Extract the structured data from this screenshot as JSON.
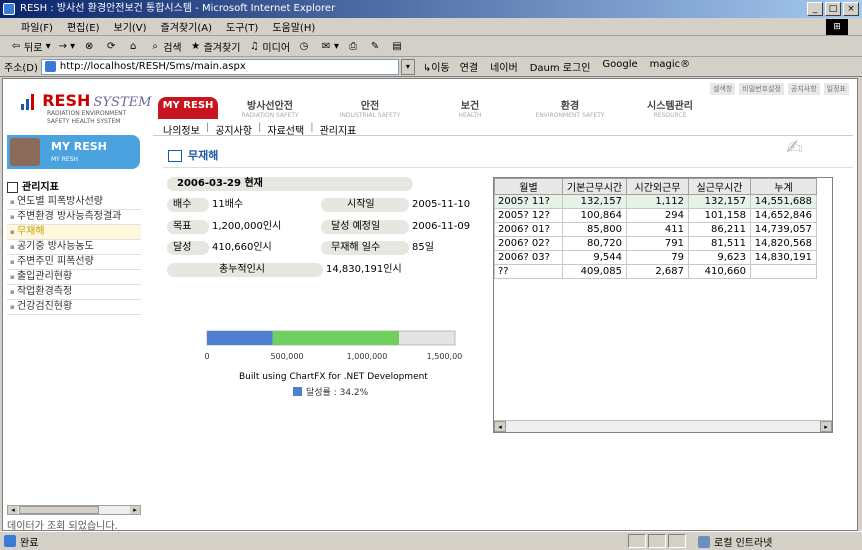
{
  "window": {
    "title": "RESH : 방사선 환경안전보건 통합시스템 - Microsoft Internet Explorer",
    "min": "_",
    "max": "□",
    "close": "×"
  },
  "menu": [
    "파일(F)",
    "편집(E)",
    "보기(V)",
    "즐겨찾기(A)",
    "도구(T)",
    "도움말(H)"
  ],
  "toolbar": {
    "back": "뒤로",
    "forward": "→",
    "search": "검색",
    "favorites": "즐겨찾기",
    "media": "미디어"
  },
  "address": {
    "label": "주소(D)",
    "url": "http://localhost/RESH/Sms/main.aspx",
    "go": "이동",
    "links_label": "연결",
    "links": [
      "네이버",
      "Daum 로그인",
      "Google",
      "magic®"
    ]
  },
  "topright": [
    "셀색창",
    "비밀번호설정",
    "공지사항",
    "일정표"
  ],
  "logo": {
    "resh": "RESH",
    "system": "SYSTEM",
    "sub1": "RADIATION ENVIRONMENT",
    "sub2": "SAFETY HEALTH SYSTEM"
  },
  "mainnav": [
    {
      "t": "MY RESH",
      "s": ""
    },
    {
      "t": "방사선안전",
      "s": "RADIATION SAFETY"
    },
    {
      "t": "안전",
      "s": "INDUSTRIAL SAFETY"
    },
    {
      "t": "보건",
      "s": "HEALTH"
    },
    {
      "t": "환경",
      "s": "ENVIRONMENT SAFETY"
    },
    {
      "t": "시스템관리",
      "s": "RESOURCE"
    }
  ],
  "subnav": [
    "나의정보",
    "공지사항",
    "자료선택",
    "관리지표"
  ],
  "myresh": {
    "t": "MY RESH",
    "s": "MY RESH"
  },
  "sidebar": {
    "title": "관리지표",
    "items": [
      "연도별 피폭방사선량",
      "주변환경 방사능측정결과",
      "무재해",
      "공기중 방사능농도",
      "주변주민 피폭선량",
      "출입관리현황",
      "작업환경측정",
      "건강검진현황"
    ],
    "active_index": 2
  },
  "status_message": "데이터가 조회 되었습니다.",
  "section_title": "무재해",
  "summary": {
    "date_label": "2006-03-29 현재",
    "multiple_label": "배수",
    "multiple_value": "11배수",
    "start_label": "시작일",
    "start_value": "2005-11-10",
    "target_label": "목표",
    "target_value": "1,200,000인시",
    "expected_label": "달성 예정일",
    "expected_value": "2006-11-09",
    "achieved_label": "달성",
    "achieved_value": "410,660인시",
    "days_label": "무재해 일수",
    "days_value": "85일",
    "total_label": "총누적인시",
    "total_value": "14,830,191인시"
  },
  "chart_data": {
    "type": "bar",
    "orientation": "horizontal",
    "ticks": [
      "0",
      "500,000",
      "1,000,000",
      "1,500,000"
    ],
    "xlim": [
      0,
      1500000
    ],
    "segments": [
      {
        "value": 410660,
        "color": "#4f7fcf"
      },
      {
        "value": 1200000,
        "color": "#6fcf5f"
      }
    ],
    "bar_max": 1550000,
    "credit": "Built using ChartFX for .NET Development",
    "legend": "달성률 : 34.2%",
    "legend_color": "#4f7fcf"
  },
  "grid": {
    "columns": [
      "월별",
      "기본근무시간",
      "시간외근무",
      "실근무시간",
      "누계"
    ],
    "rows": [
      [
        "2005? 11?",
        "132,157",
        "1,112",
        "132,157",
        "14,551,688"
      ],
      [
        "2005? 12?",
        "100,864",
        "294",
        "101,158",
        "14,652,846"
      ],
      [
        "2006? 01?",
        "85,800",
        "411",
        "86,211",
        "14,739,057"
      ],
      [
        "2006? 02?",
        "80,720",
        "791",
        "81,511",
        "14,820,568"
      ],
      [
        "2006? 03?",
        "9,544",
        "79",
        "9,623",
        "14,830,191"
      ],
      [
        "??",
        "409,085",
        "2,687",
        "410,660",
        ""
      ]
    ]
  },
  "statusbar": {
    "done": "완료",
    "zone": "로컬 인트라넷"
  }
}
